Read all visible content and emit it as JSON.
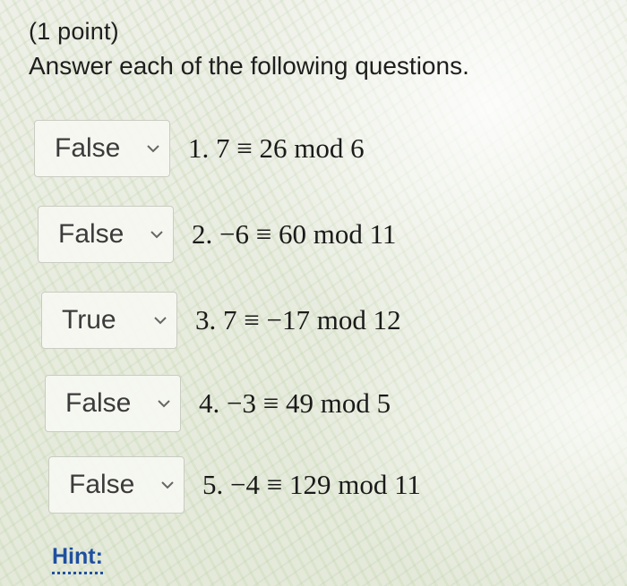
{
  "header": {
    "points": "(1 point)",
    "instructions": "Answer each of the following questions."
  },
  "questions": [
    {
      "selected": "False",
      "statement": "1. 7 ≡ 26 mod 6"
    },
    {
      "selected": "False",
      "statement": "2. −6 ≡ 60 mod 11"
    },
    {
      "selected": "True",
      "statement": "3. 7 ≡ −17 mod 12"
    },
    {
      "selected": "False",
      "statement": "4. −3 ≡ 49 mod 5"
    },
    {
      "selected": "False",
      "statement": "5. −4 ≡ 129 mod 11"
    }
  ],
  "hint": {
    "label": "Hint:"
  },
  "colors": {
    "hint_link": "#1f4fa0",
    "select_border": "#c9ccc2"
  },
  "icons": {
    "dropdown": "chevron-down-icon"
  }
}
